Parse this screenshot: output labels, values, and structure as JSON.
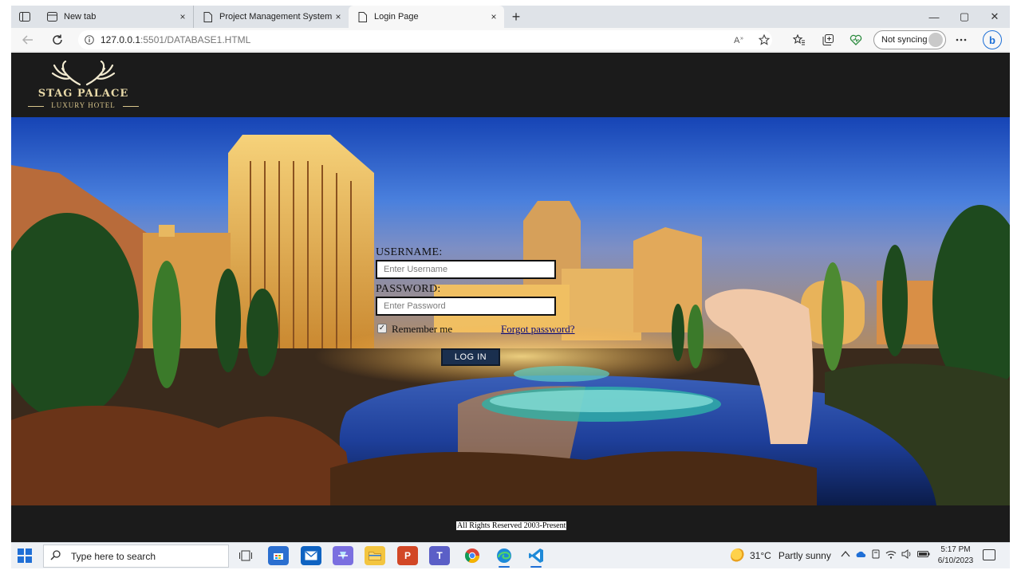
{
  "browser": {
    "tabs": [
      {
        "title": "New tab",
        "close": "×"
      },
      {
        "title": "Project Management System",
        "close": "×"
      },
      {
        "title": "Login Page",
        "close": "×"
      }
    ],
    "new_tab_glyph": "+",
    "window_controls": {
      "minimize": "—",
      "maximize": "▢",
      "close": "✕"
    },
    "url_host": "127.0.0.1",
    "url_path": ":5501/DATABASE1.HTML",
    "sync_label": "Not syncing"
  },
  "site": {
    "logo_title": "STAG PALACE",
    "logo_subtitle": "LUXURY HOTEL",
    "login": {
      "username_label": "USERNAME:",
      "username_placeholder": "Enter Username",
      "password_label": "PASSWORD:",
      "password_placeholder": "Enter Password",
      "remember_label": "Remember me",
      "forgot_label": "Forgot password?",
      "login_button": "LOG IN"
    },
    "footer": "All Rights Reserved 2003-Present"
  },
  "taskbar": {
    "search_placeholder": "Type here to search",
    "weather_temp": "31°C",
    "weather_desc": "Partly sunny",
    "time": "5:17 PM",
    "date": "6/10/2023"
  },
  "colors": {
    "accent": "#1f6fd6",
    "page_bg": "#1b1b1b",
    "login_button": "#1a2f4e",
    "logo_gold": "#e8d9a8"
  },
  "icons": [
    "tab-actions-icon",
    "newtab-page-icon",
    "document-icon",
    "back-arrow-icon",
    "refresh-icon",
    "info-icon",
    "read-aloud-icon",
    "favorite-star-icon",
    "favorites-icon",
    "collections-icon",
    "browser-essentials-icon",
    "more-icon",
    "bing-icon",
    "windows-start-icon",
    "search-icon",
    "task-view-icon",
    "store-icon",
    "mail-icon",
    "copilot-icon",
    "file-explorer-icon",
    "powerpoint-icon",
    "teams-icon",
    "chrome-icon",
    "edge-icon",
    "vscode-icon",
    "weather-icon",
    "chevron-up-icon",
    "onedrive-icon",
    "network-icon",
    "wifi-icon",
    "volume-icon",
    "battery-icon",
    "notification-icon",
    "stag-antlers-icon"
  ]
}
